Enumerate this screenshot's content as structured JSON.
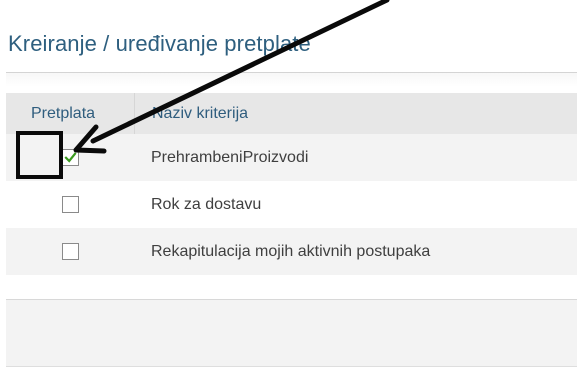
{
  "panel": {
    "title": "Kreiranje / uređivanje pretplate"
  },
  "table": {
    "columns": [
      "Pretplata",
      "Naziv kriterija"
    ],
    "rows": [
      {
        "checked": true,
        "label": "PrehrambeniProizvodi"
      },
      {
        "checked": false,
        "label": "Rok za dostavu"
      },
      {
        "checked": false,
        "label": "Rekapitulacija mojih aktivnih postupaka"
      }
    ]
  },
  "colors": {
    "title": "#2e5f7f",
    "header_text": "#2f5d7e",
    "check_mark": "#3a9a1e",
    "annotation": "#0a0a0a"
  }
}
